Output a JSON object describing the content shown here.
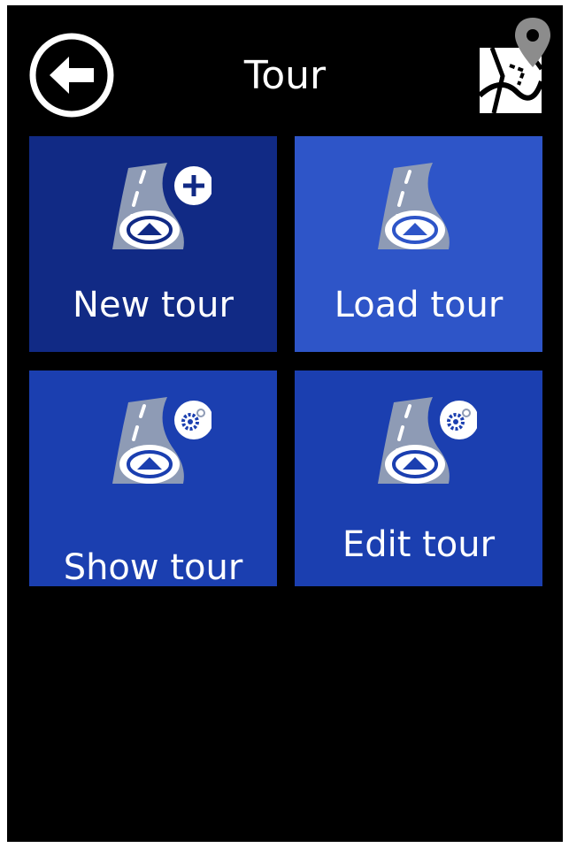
{
  "header": {
    "title": "Tour",
    "back_icon": "back-arrow-icon",
    "map_icon": "map-pin-icon"
  },
  "tiles": [
    {
      "label": "New tour",
      "icon": "road-plus-icon",
      "color": "#112a85"
    },
    {
      "label": "Load tour",
      "icon": "road-icon",
      "color": "#2e55c8"
    },
    {
      "label": "Show tour",
      "icon": "road-gear-icon",
      "color": "#1b3fb0"
    },
    {
      "label": "Edit tour",
      "icon": "road-gear-icon",
      "color": "#1b3fb0"
    }
  ],
  "colors": {
    "background": "#000000",
    "text": "#ffffff",
    "icon_gray": "#8e9bb5"
  }
}
